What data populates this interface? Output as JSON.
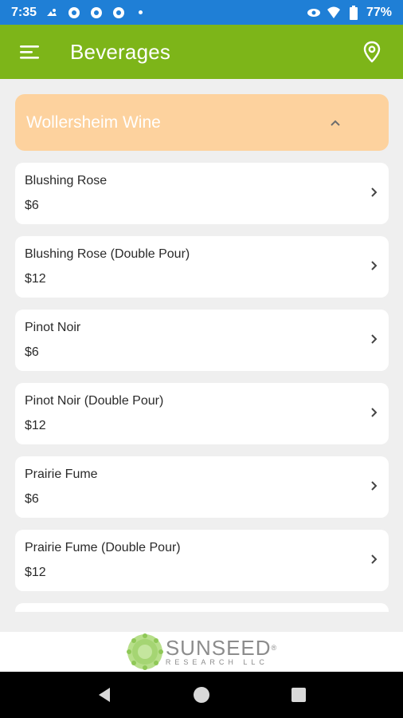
{
  "status_bar": {
    "time": "7:35",
    "battery_percent": "77%",
    "icons": [
      "cloud-sun-icon",
      "chrome-icon",
      "chrome-icon",
      "chrome-icon",
      "notification-dot",
      "vpn-key-icon",
      "wifi-icon",
      "battery-icon"
    ]
  },
  "app_bar": {
    "title": "Beverages",
    "menu_icon": "menu-icon",
    "location_icon": "location-pin-icon",
    "color": "#7db519"
  },
  "category": {
    "title": "Wollersheim Wine",
    "expanded": true,
    "color": "#fdd29e"
  },
  "items": [
    {
      "name": "Blushing Rose",
      "price": "$6"
    },
    {
      "name": "Blushing Rose (Double Pour)",
      "price": "$12"
    },
    {
      "name": "Pinot Noir",
      "price": "$6"
    },
    {
      "name": "Pinot Noir (Double Pour)",
      "price": "$12"
    },
    {
      "name": "Prairie Fume",
      "price": "$6"
    },
    {
      "name": "Prairie Fume (Double Pour)",
      "price": "$12"
    }
  ],
  "footer": {
    "logo_name": "SUNSEED",
    "logo_reg": "®",
    "logo_sub": "RESEARCH LLC"
  },
  "nav_bar": {
    "back_icon": "back-triangle-icon",
    "home_icon": "home-circle-icon",
    "recents_icon": "recents-square-icon"
  }
}
